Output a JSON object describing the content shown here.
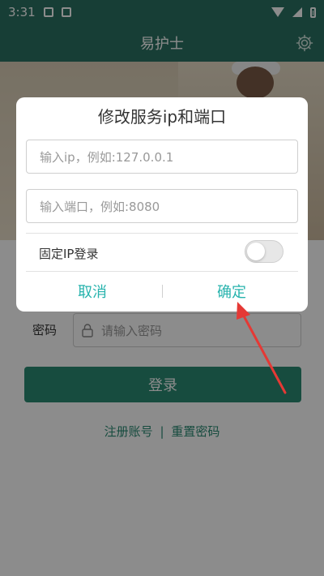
{
  "status_bar": {
    "time": "3:31"
  },
  "app_bar": {
    "title": "易护士",
    "settings_icon": "gear-icon"
  },
  "login": {
    "password_label": "密码",
    "password_placeholder": "请输入密码",
    "login_button": "登录",
    "register_link": "注册账号",
    "separator": "|",
    "reset_link": "重置密码"
  },
  "dialog": {
    "title": "修改服务ip和端口",
    "ip_placeholder": "输入ip，例如:127.0.0.1",
    "port_placeholder": "输入端口，例如:8080",
    "fixed_ip_label": "固定IP登录",
    "fixed_ip_enabled": false,
    "cancel": "取消",
    "confirm": "确定",
    "accent_color": "#27b3ad"
  },
  "annotation": {
    "arrow_color": "#e53935"
  }
}
